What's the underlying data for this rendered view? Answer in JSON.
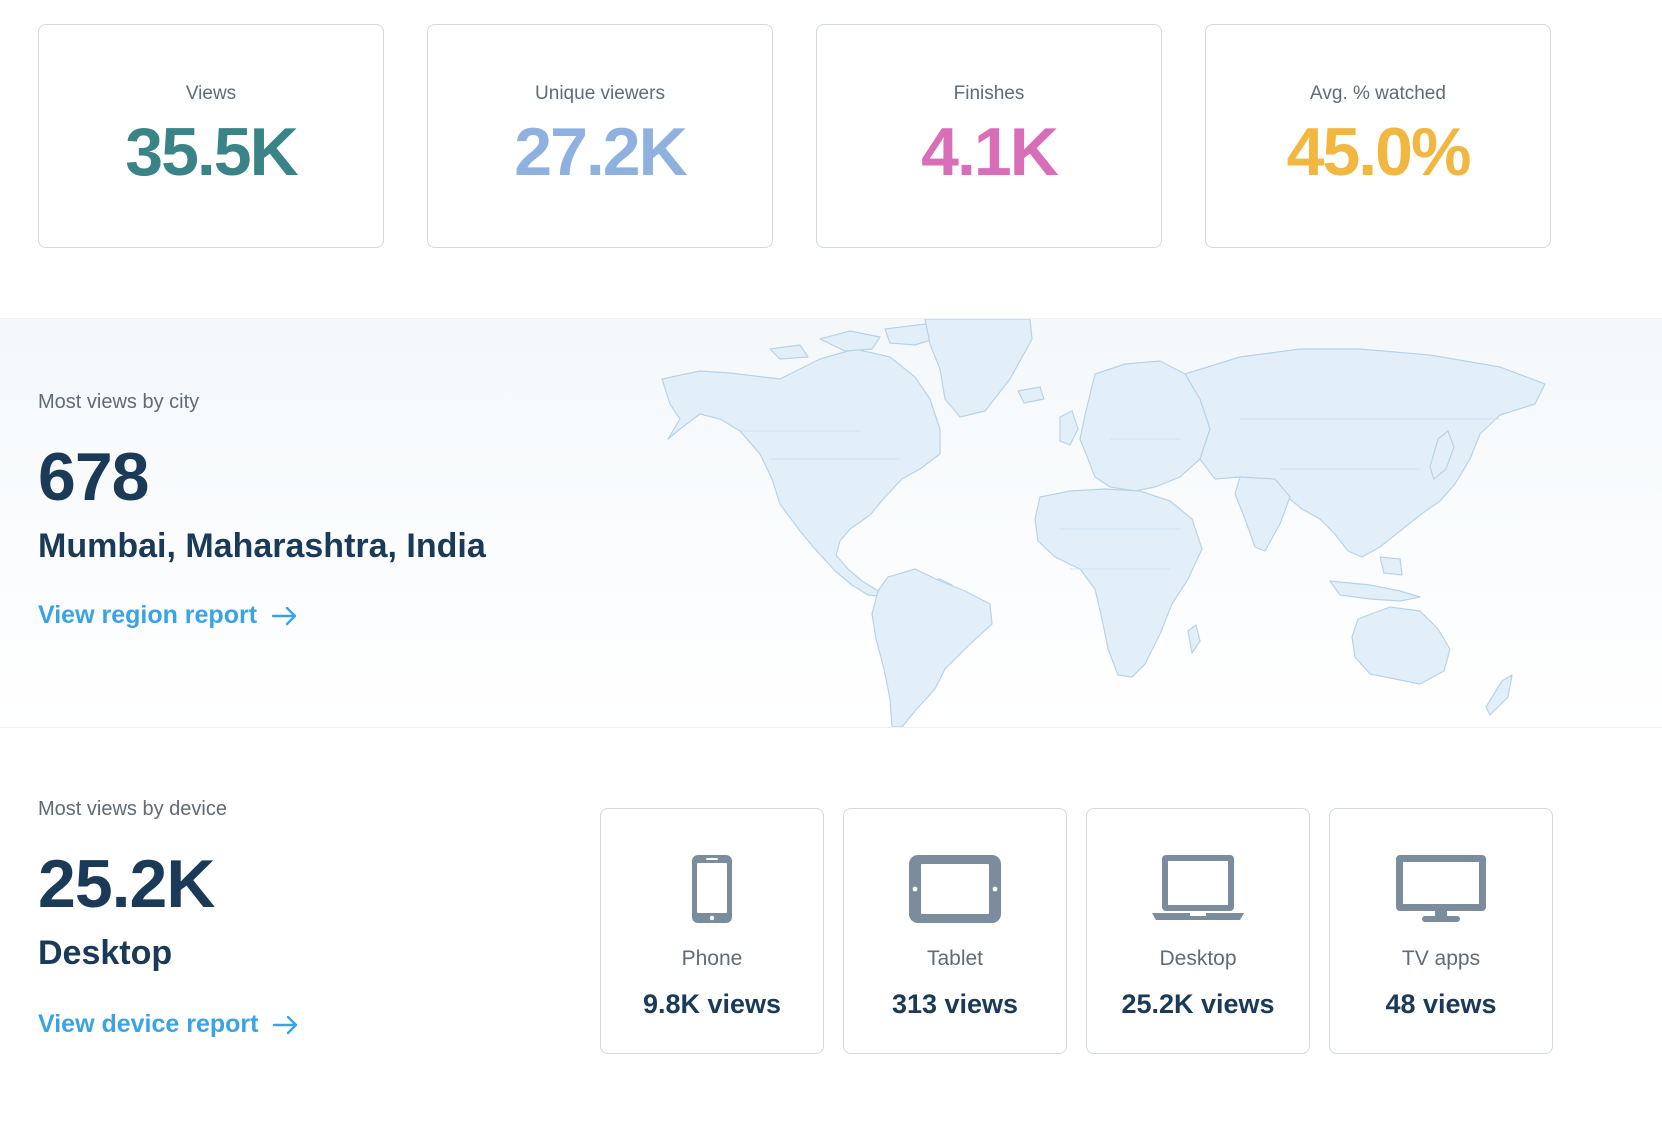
{
  "stats": [
    {
      "label": "Views",
      "value": "35.5K",
      "color": "#3a8488"
    },
    {
      "label": "Unique viewers",
      "value": "27.2K",
      "color": "#8fb1df"
    },
    {
      "label": "Finishes",
      "value": "4.1K",
      "color": "#d96eb8"
    },
    {
      "label": "Avg. % watched",
      "value": "45.0%",
      "color": "#f2b740"
    }
  ],
  "city": {
    "label": "Most views by city",
    "count": "678",
    "name": "Mumbai, Maharashtra, India",
    "link": "View region report",
    "map_icon": "world-map"
  },
  "device": {
    "label": "Most views by device",
    "count": "25.2K",
    "name": "Desktop",
    "link": "View device report",
    "cards": [
      {
        "icon": "phone-icon",
        "name": "Phone",
        "views": "9.8K views"
      },
      {
        "icon": "tablet-icon",
        "name": "Tablet",
        "views": "313 views"
      },
      {
        "icon": "laptop-icon",
        "name": "Desktop",
        "views": "25.2K views"
      },
      {
        "icon": "tv-icon",
        "name": "TV apps",
        "views": "48 views"
      }
    ]
  },
  "colors": {
    "link": "#3aa3e3",
    "heading": "#1b3a57",
    "icon": "#7b8c9c",
    "map_fill": "#e3eff8",
    "map_stroke": "#b9d3e6"
  }
}
